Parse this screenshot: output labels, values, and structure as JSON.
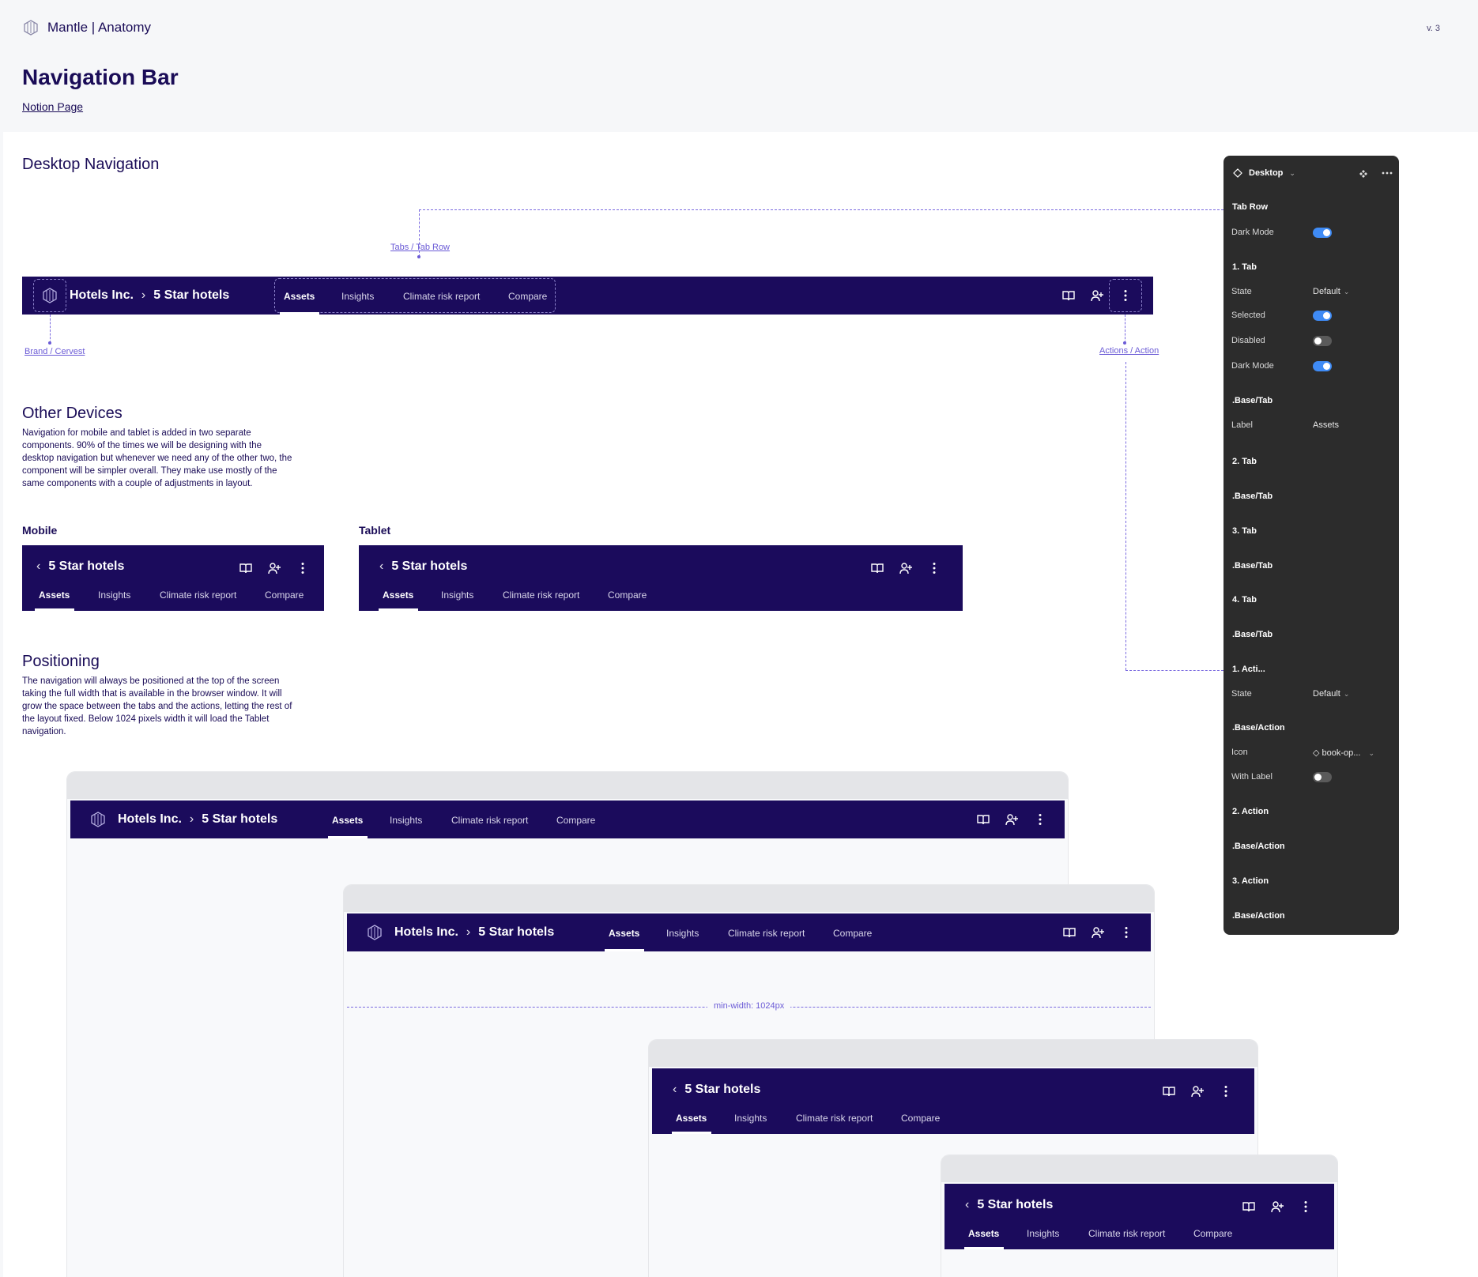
{
  "header": {
    "brand": "Mantle | Anatomy",
    "version": "v. 3",
    "title": "Navigation Bar",
    "link": "Notion Page"
  },
  "sections": {
    "desktop_title": "Desktop Navigation",
    "other_title": "Other Devices",
    "other_text": "Navigation for mobile and tablet is added in two separate components. 90% of the times we will be designing with the desktop navigation but whenever we need any of the other two, the component will be simpler overall. They make use mostly of the same components with a couple of adjustments in layout.",
    "mobile_label": "Mobile",
    "tablet_label": "Tablet",
    "positioning_title": "Positioning",
    "positioning_text": "The navigation will always be positioned at the top of the screen taking the full width that is available in the browser window. It will grow the space between the tabs and the actions, letting the rest of the layout fixed. Below 1024 pixels width it will load the Tablet navigation."
  },
  "annotations": {
    "tabs": "Tabs / Tab Row",
    "brand": "Brand / Cervest",
    "actions": "Actions / Action",
    "min_width": "min-width: 1024px"
  },
  "nav": {
    "company": "Hotels Inc.",
    "chevron": "›",
    "page": "5 Star hotels",
    "back": "‹",
    "tabs": [
      "Assets",
      "Insights",
      "Climate risk report",
      "Compare"
    ],
    "icons": [
      "book-open-icon",
      "user-plus-icon",
      "more-vertical-icon"
    ]
  },
  "panel": {
    "title": "Desktop",
    "rows": [
      {
        "label": "Tab Row",
        "type": "heading"
      },
      {
        "label": "Dark Mode",
        "type": "toggle",
        "value": true
      },
      {
        "label": "1. Tab",
        "type": "heading"
      },
      {
        "label": "State",
        "type": "select",
        "value": "Default"
      },
      {
        "label": "Selected",
        "type": "toggle",
        "value": true
      },
      {
        "label": "Disabled",
        "type": "toggle",
        "value": false
      },
      {
        "label": "Dark Mode",
        "type": "toggle",
        "value": true
      },
      {
        "label": ".Base/Tab",
        "type": "heading"
      },
      {
        "label": "Label",
        "type": "text",
        "value": "Assets"
      },
      {
        "label": "2. Tab",
        "type": "heading"
      },
      {
        "label": ".Base/Tab",
        "type": "heading"
      },
      {
        "label": "3. Tab",
        "type": "heading"
      },
      {
        "label": ".Base/Tab",
        "type": "heading"
      },
      {
        "label": "4. Tab",
        "type": "heading"
      },
      {
        "label": ".Base/Tab",
        "type": "heading"
      },
      {
        "label": "1. Acti...",
        "type": "heading"
      },
      {
        "label": "State",
        "type": "select",
        "value": "Default"
      },
      {
        "label": ".Base/Action",
        "type": "heading"
      },
      {
        "label": "Icon",
        "type": "icon-select",
        "value": "book-op..."
      },
      {
        "label": "With Label",
        "type": "toggle",
        "value": false
      },
      {
        "label": "2. Action",
        "type": "heading"
      },
      {
        "label": ".Base/Action",
        "type": "heading"
      },
      {
        "label": "3. Action",
        "type": "heading"
      },
      {
        "label": ".Base/Action",
        "type": "heading"
      }
    ]
  },
  "colors": {
    "nav_bg": "#1b0b5c",
    "accent": "#6b5bd6",
    "panel_bg": "#2c2c2c",
    "toggle_on": "#3f8bf5"
  }
}
